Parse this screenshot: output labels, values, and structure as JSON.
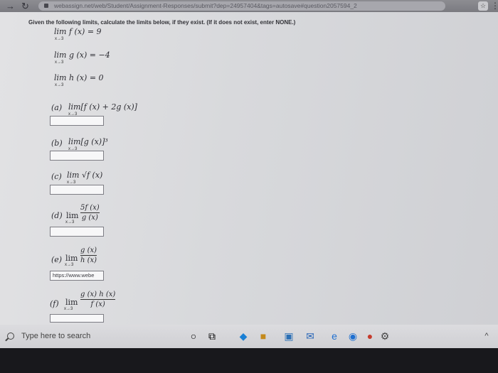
{
  "browser": {
    "url": "webassign.net/web/Student/Assignment-Responses/submit?dep=24957404&tags=autosave#question2057594_2"
  },
  "question": {
    "instructions": "Given the following limits, calculate the limits below, if they exist. (If it does not exist, enter NONE.)",
    "given": [
      {
        "expr": "lim f (x) = 9",
        "sub": "x→3"
      },
      {
        "expr": "lim g (x) = −4",
        "sub": "x→3"
      },
      {
        "expr": "lim h (x) = 0",
        "sub": "x→3"
      }
    ],
    "parts": [
      {
        "label": "(a)",
        "expr": "lim[f (x) + 2g (x)]",
        "sub": "x→3"
      },
      {
        "label": "(b)",
        "expr": "lim[g (x)]³",
        "sub": "x→3"
      },
      {
        "label": "(c)",
        "expr": "lim √f (x)",
        "sub": "x→3"
      },
      {
        "label": "(d)",
        "num": "5f (x)",
        "den": "g (x)",
        "sub": "x→3"
      },
      {
        "label": "(e)",
        "num": "g (x)",
        "den": "h (x)",
        "sub": "x→3"
      },
      {
        "label": "(f)",
        "num": "g (x) h (x)",
        "den": "f (x)",
        "sub": "x→3"
      }
    ],
    "answer_e_value": "https://www.webe"
  },
  "taskbar": {
    "search_placeholder": "Type here to search"
  }
}
